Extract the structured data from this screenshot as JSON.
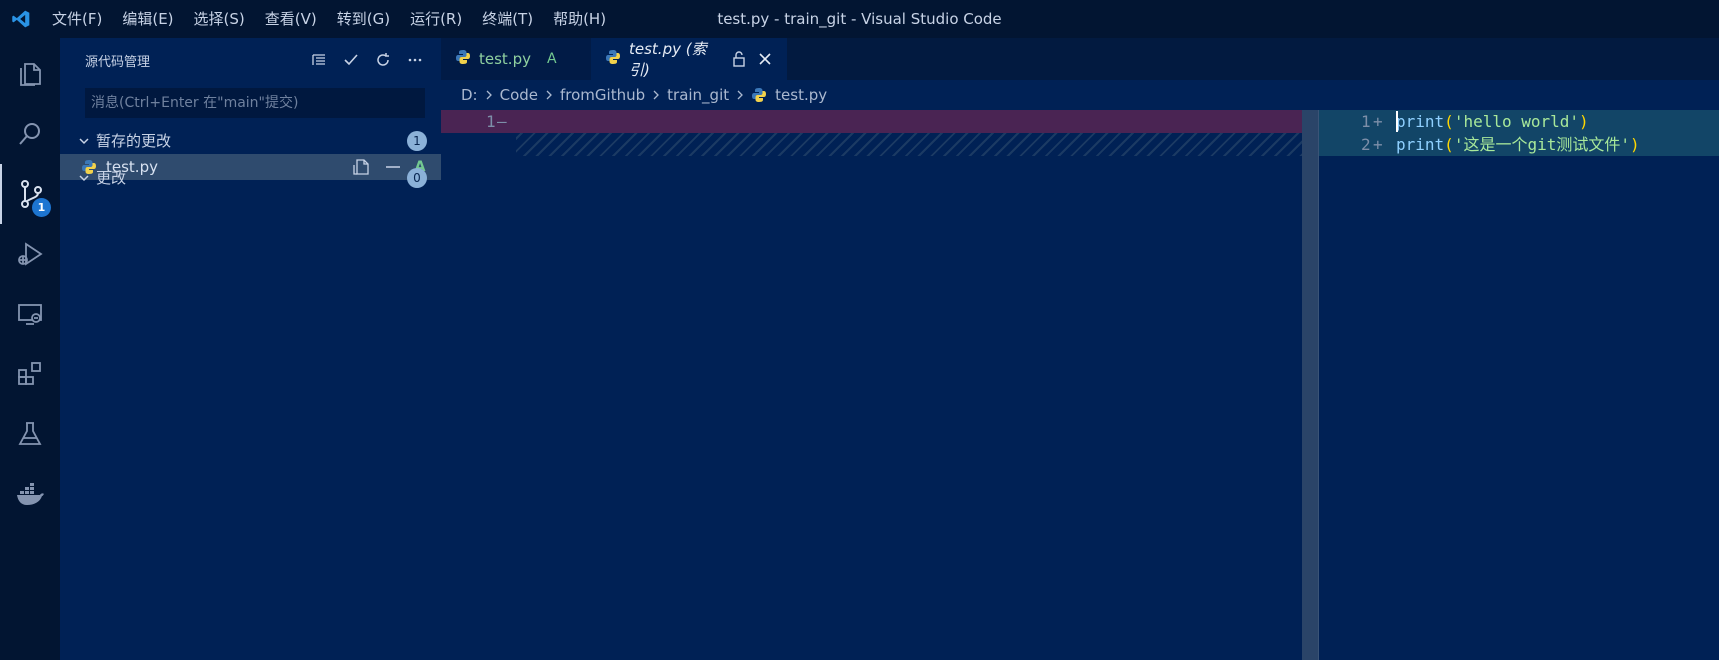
{
  "window": {
    "title": "test.py - train_git - Visual Studio Code"
  },
  "menu": [
    "文件(F)",
    "编辑(E)",
    "选择(S)",
    "查看(V)",
    "转到(G)",
    "运行(R)",
    "终端(T)",
    "帮助(H)"
  ],
  "activity_bar": {
    "source_control_badge": "1"
  },
  "sidebar": {
    "title": "源代码管理",
    "commit_placeholder": "消息(Ctrl+Enter 在\"main\"提交)",
    "staged": {
      "label": "暂存的更改",
      "count": "1"
    },
    "staged_file": {
      "name": "test.py",
      "status": "A"
    },
    "changes": {
      "label": "更改",
      "count": "0"
    }
  },
  "tabs": [
    {
      "label": "test.py",
      "status": "A"
    },
    {
      "label": "test.py (索引)"
    }
  ],
  "breadcrumb": [
    "D:",
    "Code",
    "fromGithub",
    "train_git",
    "test.py"
  ],
  "editor": {
    "left": {
      "line": "1",
      "marker": "—"
    },
    "right": [
      {
        "line": "1",
        "marker": "+",
        "fn": "print",
        "open": "(",
        "str": "'hello world'",
        "close": ")"
      },
      {
        "line": "2",
        "marker": "+",
        "fn": "print",
        "open": "(",
        "str": "'这是一个git测试文件'",
        "close": ")"
      }
    ]
  },
  "colors": {
    "accent": "#1d75d1",
    "added": "#73c991",
    "background": "#002155"
  }
}
